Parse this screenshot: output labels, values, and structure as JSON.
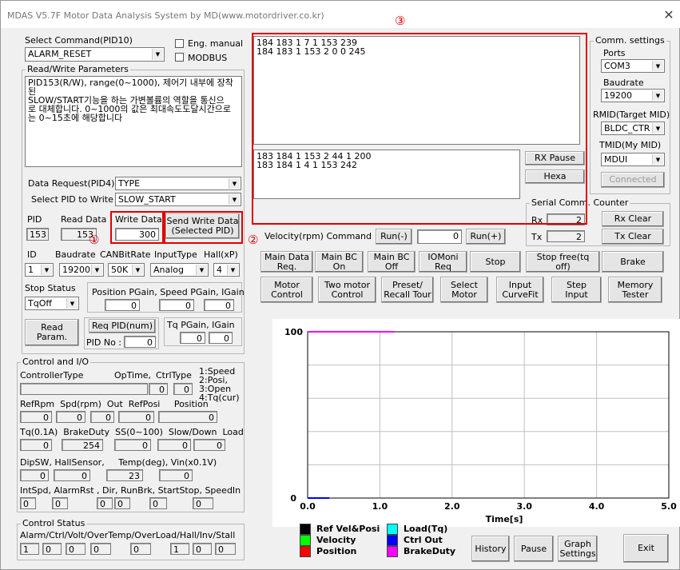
{
  "window": {
    "title": "MDAS V5.7F Motor Data Analysis System by MD(www.motordriver.co.kr)",
    "close": "✕"
  },
  "left": {
    "select_command_label": "Select Command(PID10)",
    "select_command_value": "ALARM_RESET",
    "eng_manual": "Eng. manual",
    "modbus": "MODBUS",
    "rw_params_title": "Read/Write Parameters",
    "rw_params_text": "PID153(R/W), range(0~1000), 제어기 내부에 장착된\nSLOW/START기능을 하는 가변볼륨의 역할을 통신으\n로 대체합니다. 0~1000의 값은 최대속도도달시간으로\n는 0~15초에 해당합니다",
    "data_request_label": "Data Request(PID4)",
    "data_request_value": "TYPE",
    "select_pid_label": "Select PID to Write",
    "select_pid_value": "SLOW_START",
    "pid_label": "PID",
    "pid_value": "153",
    "read_data_label": "Read Data",
    "read_data_value": "153",
    "write_data_label": "Write Data",
    "write_data_value": "300",
    "send_write_label": "Send Write Data\n(Selected PID)",
    "id_label": "ID",
    "id_value": "1",
    "baudrate_label": "Baudrate",
    "baudrate_value": "19200",
    "canbit_label": "CANBitRate",
    "canbit_value": "50K",
    "inputtype_label": "InputType",
    "inputtype_value": "Analog",
    "hall_label": "Hall(xP)",
    "hall_value": "4",
    "stop_status_label": "Stop Status",
    "stop_status_value": "TqOff",
    "pgain_label": "Position PGain, Speed PGain, IGain",
    "pgain_values": [
      "0",
      "0",
      "0"
    ],
    "read_param_label": "Read\nParam.",
    "req_pid_label": "Req PID(num)",
    "pid_no_label": "PID No :",
    "pid_no_value": "0",
    "tq_gain_label": "Tq PGain, IGain",
    "tq_gain_values": [
      "0",
      "0"
    ]
  },
  "control_io": {
    "title": "Control and I/O",
    "controller_type": "ControllerType",
    "optime": "OpTime,",
    "ctrltype": "CtrlType",
    "ctrl_legend": "1:Speed\n2:Posi,\n3:Open\n4:Tq(cur)",
    "optime_value": "0",
    "ctrltype_value": "0",
    "row2_labels": "RefRpm  Spd(rpm)  Out  RefPosi     Position",
    "row2_values": [
      "0",
      "0",
      "0",
      "0",
      "0"
    ],
    "row3_labels": "Tq(0.1A)  BrakeDuty  SS(0~100)  Slow/Down  Load",
    "row3_values": [
      "0",
      "254",
      "0",
      "0",
      "0"
    ],
    "row4_labels": "DipSW, HallSensor,     Temp(deg), Vin(x0.1V)",
    "row4_values": [
      "0",
      "0",
      "23",
      "0"
    ],
    "row5_labels": "IntSpd, AlarmRst , Dir, RunBrk, StartStop, SpeedIn",
    "row5_values": [
      "0",
      "0",
      "0",
      "0",
      "0",
      "0"
    ]
  },
  "control_status": {
    "title": "Control Status",
    "labels": "Alarm/Ctrl/Volt/OverTemp/OverLoad/Hall/Inv/Stall",
    "values": [
      "1",
      "0",
      "0",
      "0",
      "0",
      "1",
      "0",
      "0"
    ]
  },
  "comm": {
    "rx_text": "184 183 1 7 1 153 239\n184 183 1 153 2 0 0 245",
    "tx_text": "183 184 1 153 2 44 1 200\n183 184 1 4 1 153 242",
    "rx_pause": "RX Pause",
    "hexa": "Hexa",
    "settings_title": "Comm. settings",
    "ports_label": "Ports",
    "ports_value": "COM3",
    "baudrate_label": "Baudrate",
    "baudrate_value": "19200",
    "rmid_label": "RMID(Target MID)",
    "rmid_value": "BLDC_CTR",
    "tmid_label": "TMID(My MID)",
    "tmid_value": "MDUI",
    "connected": "Connected",
    "counter_title": "Serial Comm. Counter",
    "rx_label": "Rx",
    "rx_value": "2",
    "tx_label": "Tx",
    "tx_value": "2",
    "rx_clear": "Rx Clear",
    "tx_clear": "Tx Clear"
  },
  "velocity": {
    "label": "Velocity(rpm) Command",
    "run_minus": "Run(-)",
    "value": "0",
    "run_plus": "Run(+)"
  },
  "buttons_row1": [
    "Main Data\nReq.",
    "Main BC\nOn",
    "Main BC\nOff",
    "IOMoni\nReq",
    "Stop",
    "Stop free(tq off)",
    "Brake"
  ],
  "buttons_row2": [
    "Motor\nControl",
    "Two motor\nControl",
    "Preset/\nRecall Tour",
    "Select\nMotor",
    "Input\nCurveFit",
    "Step\nInput",
    "Memory\nTester"
  ],
  "annotations": {
    "c1": "①",
    "c2": "②",
    "c3": "③"
  },
  "chart_data": {
    "type": "line",
    "xlabel": "Time[s]",
    "ylim": [
      0,
      100
    ],
    "xlim": [
      0,
      5
    ],
    "y_ticks": [
      "100",
      "0"
    ],
    "x_ticks": [
      "0.0",
      "1.0",
      "2.0",
      "3.0",
      "4.0",
      "5.0"
    ],
    "series": [
      {
        "name": "Ref Vel&Posi",
        "color": "#000000",
        "x": [
          0,
          0.3
        ],
        "y": [
          0,
          0
        ]
      },
      {
        "name": "Velocity",
        "color": "#00ff00",
        "x": [
          0,
          0.3
        ],
        "y": [
          0,
          0
        ]
      },
      {
        "name": "Position",
        "color": "#ff0000",
        "x": [
          0,
          0.3
        ],
        "y": [
          0,
          0
        ]
      },
      {
        "name": "Load(Tq)",
        "color": "#00ffff",
        "x": [
          0,
          0.3
        ],
        "y": [
          0,
          0
        ]
      },
      {
        "name": "Ctrl Out",
        "color": "#0000ff",
        "x": [
          0,
          0.3
        ],
        "y": [
          0,
          0
        ]
      },
      {
        "name": "BrakeDuty",
        "color": "#ff00ff",
        "x": [
          0,
          1.2
        ],
        "y": [
          100,
          100
        ]
      }
    ]
  },
  "bottom_buttons": {
    "history": "History",
    "pause": "Pause",
    "graph_settings": "Graph\nSettings",
    "exit": "Exit"
  }
}
